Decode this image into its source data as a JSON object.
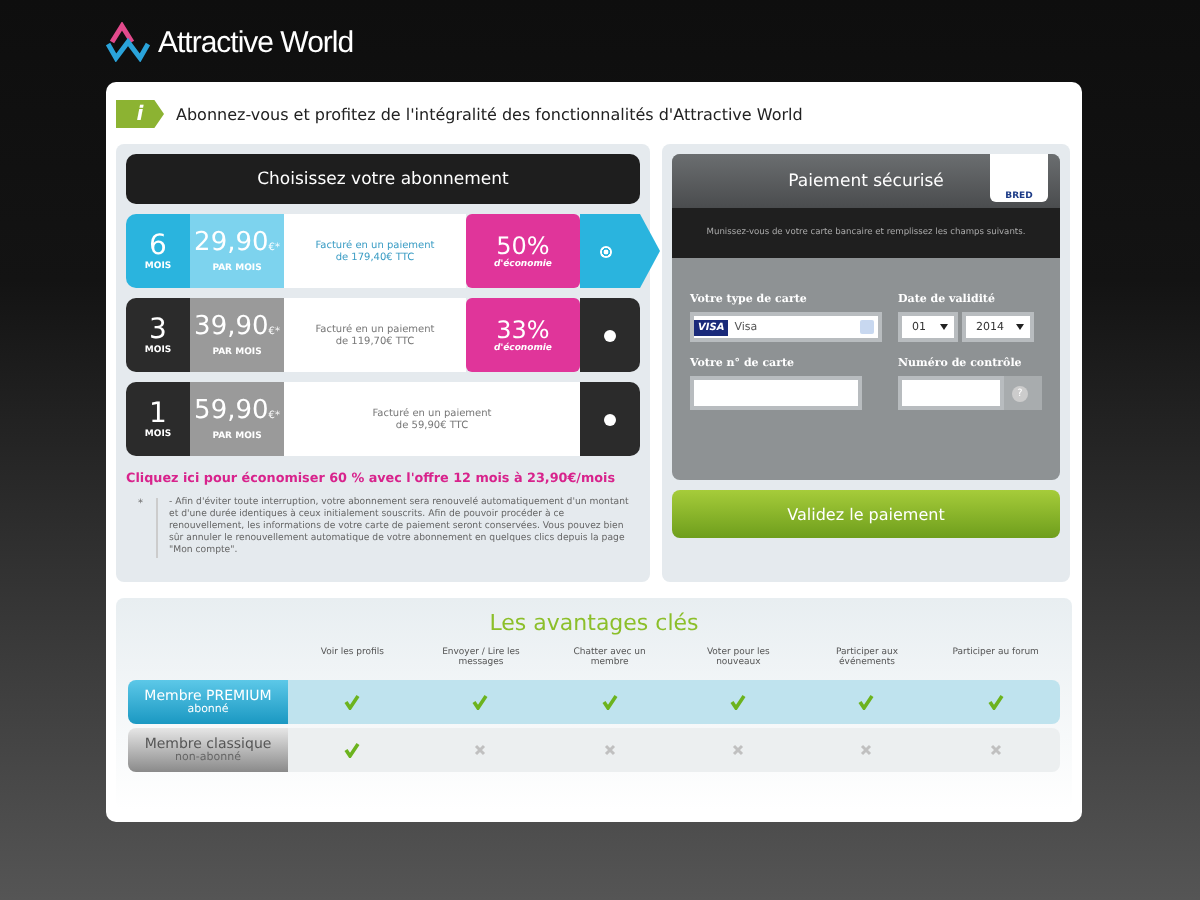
{
  "brand": "Attractive World",
  "banner": {
    "icon": "i",
    "text": "Abonnez-vous et profitez de l'intégralité des fonctionnalités d'Attractive World"
  },
  "plans_title": "Choisissez votre abonnement",
  "plans": [
    {
      "months": "6",
      "months_unit": "MOIS",
      "price": "29,90",
      "currency": "€*",
      "per": "PAR MOIS",
      "billing": "Facturé en un paiement de 179,40€ TTC",
      "discount": "50%",
      "discount_label": "d'économie",
      "selected": true
    },
    {
      "months": "3",
      "months_unit": "MOIS",
      "price": "39,90",
      "currency": "€*",
      "per": "PAR MOIS",
      "billing": "Facturé en un paiement de 119,70€ TTC",
      "discount": "33%",
      "discount_label": "d'économie",
      "selected": false
    },
    {
      "months": "1",
      "months_unit": "MOIS",
      "price": "59,90",
      "currency": "€*",
      "per": "PAR MOIS",
      "billing": "Facturé en un paiement de 59,90€ TTC",
      "selected": false
    }
  ],
  "offer_link": "Cliquez ici pour économiser 60 % avec l'offre 12 mois à 23,90€/mois",
  "footnote": {
    "mark": "*",
    "text": "- Afin d'éviter toute interruption, votre abonnement sera renouvelé automatiquement d'un montant et d'une durée identiques à ceux initialement souscrits. Afin de pouvoir procéder à ce renouvellement, les informations de votre carte de paiement seront conservées. Vous pouvez bien sûr annuler le renouvellement automatique de votre abonnement en quelques clics depuis la page \"Mon compte\"."
  },
  "payment": {
    "title": "Paiement sécurisé",
    "bank": "BRED",
    "subtitle": "Munissez-vous de votre carte bancaire et remplissez les champs suivants.",
    "card_type_label": "Votre type de carte",
    "card_brand": "VISA",
    "card_type": "Visa",
    "expiry_label": "Date de validité",
    "expiry_month": "01",
    "expiry_year": "2014",
    "card_number_label": "Votre n° de carte",
    "cvv_label": "Numéro de contrôle",
    "help": "?",
    "submit": "Validez le paiement"
  },
  "advantages": {
    "title": "Les avantages clés",
    "columns": [
      "Voir les profils",
      "Envoyer / Lire les messages",
      "Chatter avec un membre",
      "Voter pour les nouveaux",
      "Participer aux événements",
      "Participer au forum"
    ],
    "rows": [
      {
        "kind": "premium",
        "name": "Membre PREMIUM",
        "status": "abonné",
        "features": [
          true,
          true,
          true,
          true,
          true,
          true
        ]
      },
      {
        "kind": "classic",
        "name": "Membre classique",
        "status": "non-abonné",
        "features": [
          true,
          false,
          false,
          false,
          false,
          false
        ]
      }
    ]
  }
}
